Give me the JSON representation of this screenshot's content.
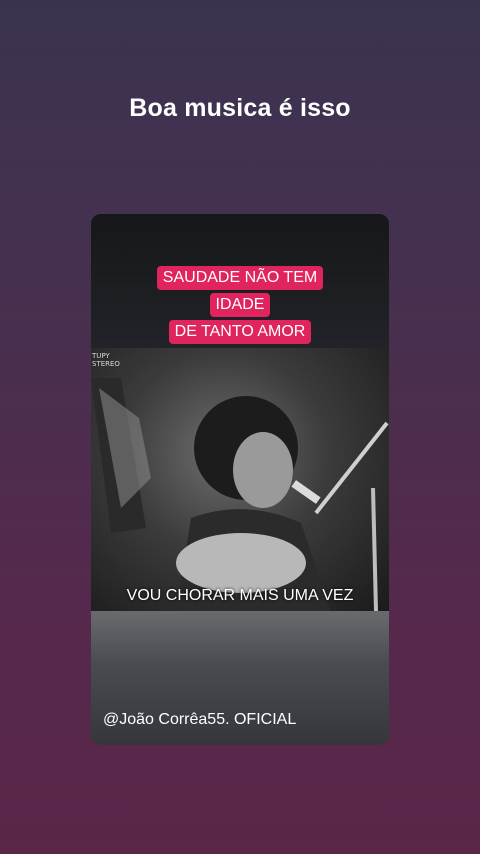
{
  "caption": "Boa musica é isso",
  "card": {
    "title_lines": [
      "SAUDADE NÃO TEM",
      "IDADE",
      "DE TANTO AMOR"
    ],
    "video": {
      "channel_mark_line1": "TUPY",
      "channel_mark_line2": "STEREO",
      "subtitle": "VOU CHORAR MAIS UMA VEZ"
    },
    "handle": "@João Corrêa55. OFICIAL"
  },
  "colors": {
    "title_background": "#e0245e",
    "page_background_top": "#3a3350",
    "page_background_bottom": "#5b2648"
  }
}
